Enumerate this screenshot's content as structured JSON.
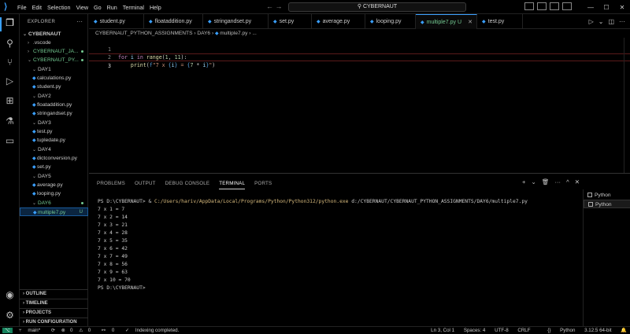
{
  "titlebar": {
    "menu": [
      "File",
      "Edit",
      "Selection",
      "View",
      "Go",
      "Run",
      "Terminal",
      "Help"
    ],
    "search": "CYBERNAUT"
  },
  "sidebar": {
    "header": "EXPLORER",
    "root": "CYBERNAUT",
    "items": [
      {
        "label": ".vscode",
        "kind": "folder-collapsed"
      },
      {
        "label": "CYBERNAUT_JA...",
        "kind": "folder-collapsed",
        "status": "dot"
      },
      {
        "label": "CYBERNAUT_PY...",
        "kind": "folder-open",
        "status": "dot"
      },
      {
        "label": "DAY1",
        "kind": "folder-open"
      },
      {
        "label": "calculations.py",
        "kind": "file"
      },
      {
        "label": "student.py",
        "kind": "file"
      },
      {
        "label": "DAY2",
        "kind": "folder-open"
      },
      {
        "label": "floataddition.py",
        "kind": "file"
      },
      {
        "label": "stringandset.py",
        "kind": "file"
      },
      {
        "label": "DAY3",
        "kind": "folder-open"
      },
      {
        "label": "test.py",
        "kind": "file"
      },
      {
        "label": "tupledate.py",
        "kind": "file"
      },
      {
        "label": "DAY4",
        "kind": "folder-open"
      },
      {
        "label": "dictconversion.py",
        "kind": "file"
      },
      {
        "label": "set.py",
        "kind": "file"
      },
      {
        "label": "DAY5",
        "kind": "folder-open"
      },
      {
        "label": "average.py",
        "kind": "file"
      },
      {
        "label": "looping.py",
        "kind": "file"
      },
      {
        "label": "DAY6",
        "kind": "folder-open"
      },
      {
        "label": "multiple7.py",
        "kind": "file",
        "status": "U"
      }
    ],
    "sections": [
      "OUTLINE",
      "TIMELINE",
      "PROJECTS",
      "RUN CONFIGURATION"
    ]
  },
  "tabs": [
    {
      "label": "student.py"
    },
    {
      "label": "floataddition.py"
    },
    {
      "label": "stringandset.py"
    },
    {
      "label": "set.py"
    },
    {
      "label": "average.py"
    },
    {
      "label": "looping.py"
    },
    {
      "label": "multiple7.py",
      "status": "U",
      "active": true
    },
    {
      "label": "test.py"
    }
  ],
  "breadcrumb": {
    "parts": [
      "CYBERNAUT_PYTHON_ASSIGNMENTS",
      "DAY6",
      "multiple7.py",
      "..."
    ]
  },
  "editor": {
    "line_numbers": [
      "1",
      "2",
      "3"
    ],
    "code": [
      "for i in range(1, 11):",
      "    print(f\"7 x {i} = {7 * i}\")",
      ""
    ],
    "current_line": 3
  },
  "panel": {
    "tabs": [
      "PROBLEMS",
      "OUTPUT",
      "DEBUG CONSOLE",
      "TERMINAL",
      "PORTS"
    ],
    "active_tab": "TERMINAL",
    "terminal": {
      "prompt": "PS D:\\CYBERNAUT> & ",
      "interpreter": "C:/Users/hariv/AppData/Local/Programs/Python/Python312/python.exe",
      "script": " d:/CYBERNAUT/CYBERNAUT_PYTHON_ASSIGNMENTS/DAY6/multiple7.py",
      "output": [
        "7 x 1 = 7",
        "7 x 2 = 14",
        "7 x 3 = 21",
        "7 x 4 = 28",
        "7 x 5 = 35",
        "7 x 6 = 42",
        "7 x 7 = 49",
        "7 x 8 = 56",
        "7 x 9 = 63",
        "7 x 10 = 70"
      ],
      "final_prompt": "PS D:\\CYBERNAUT>"
    },
    "terminal_list": [
      "Python",
      "Python"
    ]
  },
  "status": {
    "branch": "main*",
    "errors": "0",
    "warnings": "0",
    "ports": "0",
    "message": "Indexing completed.",
    "position": "Ln 3, Col 1",
    "spaces": "Spaces: 4",
    "encoding": "UTF-8",
    "eol": "CRLF",
    "language": "Python",
    "version": "3.12.5 64-bit"
  },
  "colors": {
    "accent": "#3aa0ff",
    "git_untracked": "#73c991",
    "path": "#d7ba7d"
  }
}
